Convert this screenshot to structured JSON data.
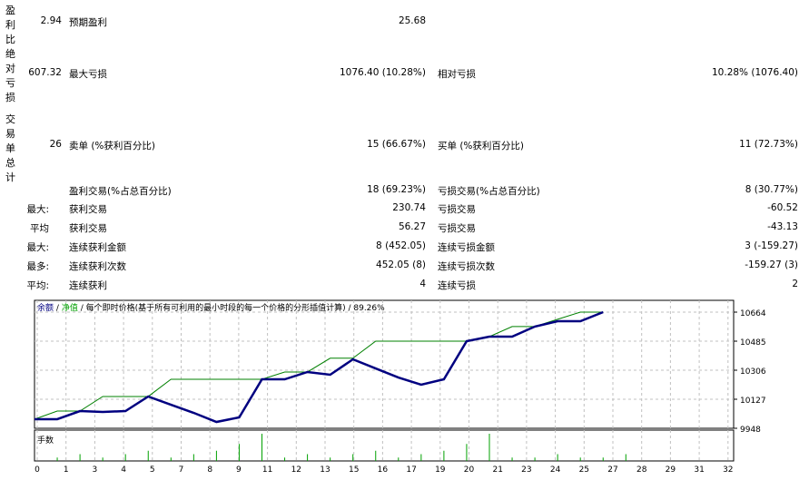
{
  "side_labels": [
    "盈利比",
    "绝对亏损",
    "交易单总计"
  ],
  "rows": [
    {
      "pre": "",
      "v0": "2.94",
      "l1": "预期盈利",
      "v1": "25.68",
      "l2": "",
      "v2": ""
    },
    {
      "pre": "",
      "v0": "607.32",
      "l1": "最大亏损",
      "v1": "1076.40 (10.28%)",
      "l2": "相对亏损",
      "v2": "10.28% (1076.40)"
    },
    {
      "pre": "",
      "v0": "26",
      "l1": "卖单 (%获利百分比)",
      "v1": "15 (66.67%)",
      "l2": "买单 (%获利百分比)",
      "v2": "11 (72.73%)"
    },
    {
      "pre": "",
      "v0": "",
      "l1": "盈利交易(%占总百分比)",
      "v1": "18 (69.23%)",
      "l2": "亏损交易(%占总百分比)",
      "v2": "8 (30.77%)"
    },
    {
      "pre": "最大:",
      "v0": "",
      "l1": "获利交易",
      "v1": "230.74",
      "l2": "亏损交易",
      "v2": "-60.52"
    },
    {
      "pre": "平均",
      "v0": "",
      "l1": "获利交易",
      "v1": "56.27",
      "l2": "亏损交易",
      "v2": "-43.13"
    },
    {
      "pre": "最大:",
      "v0": "",
      "l1": "连续获利金额",
      "v1": "8 (452.05)",
      "l2": "连续亏损金额",
      "v2": "3 (-159.27)"
    },
    {
      "pre": "最多:",
      "v0": "",
      "l1": "连续获利次数",
      "v1": "452.05 (8)",
      "l2": "连续亏损次数",
      "v2": "-159.27 (3)"
    },
    {
      "pre": "平均:",
      "v0": "",
      "l1": "连续获利",
      "v1": "4",
      "l2": "连续亏损",
      "v2": "2"
    }
  ],
  "chart_data": {
    "type": "line",
    "header": {
      "balance": "余额",
      "sep": "/",
      "equity": "净值",
      "model": "/ 每个即时价格(基于所有可利用的最小时段的每一个价格的分形插值计算) / 89.26%"
    },
    "volume_label": "手数",
    "y_ticks": [
      10664,
      10485,
      10306,
      10127,
      9948
    ],
    "ylim": [
      9948,
      10664
    ],
    "x_tick_labels": [
      "0",
      "1",
      "3",
      "4",
      "5",
      "7",
      "8",
      "9",
      "11",
      "12",
      "13",
      "15",
      "16",
      "17",
      "19",
      "20",
      "21",
      "23",
      "24",
      "25",
      "27",
      "28",
      "29",
      "31",
      "32"
    ],
    "series": [
      {
        "name": "余额",
        "color": "#000080",
        "values": [
          10004,
          10004,
          10054,
          10049,
          10054,
          10144,
          10093,
          10043,
          9987,
          10015,
          10250,
          10250,
          10295,
          10278,
          10373,
          10317,
          10261,
          10217,
          10250,
          10485,
          10513,
          10513,
          10575,
          10608,
          10608,
          10664
        ]
      },
      {
        "name": "净值",
        "color": "#008000",
        "values": [
          10004,
          10054,
          10054,
          10144,
          10144,
          10144,
          10250,
          10250,
          10250,
          10250,
          10250,
          10295,
          10295,
          10380,
          10380,
          10485,
          10485,
          10485,
          10485,
          10485,
          10513,
          10575,
          10575,
          10620,
          10664,
          10664
        ]
      }
    ],
    "volume": [
      1,
      2,
      1,
      2,
      3,
      1,
      2,
      3,
      5,
      8,
      1,
      2,
      1,
      2,
      3,
      1,
      2,
      3,
      5,
      8,
      1,
      1,
      2,
      1,
      1,
      2
    ]
  }
}
